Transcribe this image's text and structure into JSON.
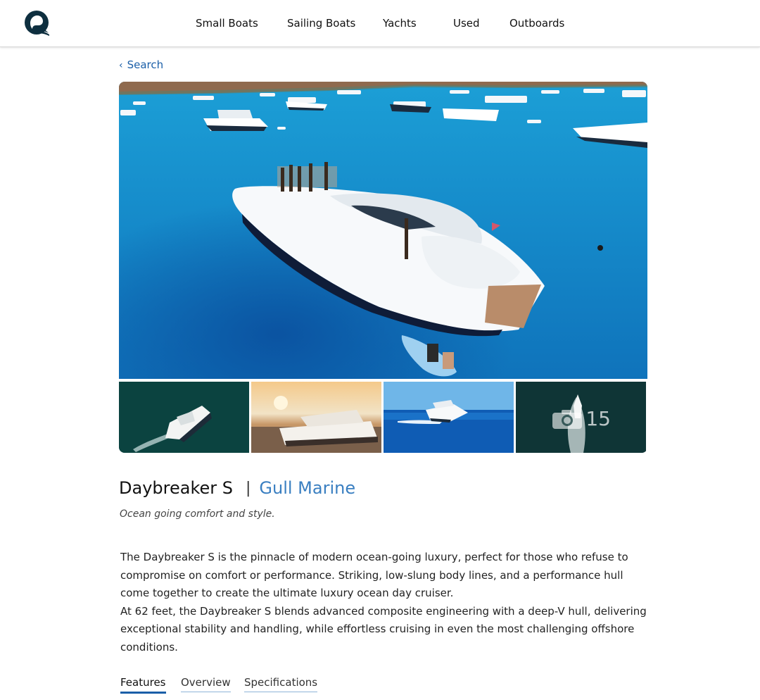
{
  "header": {
    "logo_icon": "seal-logo-icon",
    "nav": [
      {
        "label": "Small Boats"
      },
      {
        "label": "Sailing Boats"
      },
      {
        "label": "Yachts"
      },
      {
        "label": "Used"
      },
      {
        "label": "Outboards"
      }
    ]
  },
  "back_link": {
    "label": "Search",
    "icon": "chevron-left-icon"
  },
  "gallery": {
    "more_photos_count": "15",
    "more_photos_icon": "camera-icon"
  },
  "product": {
    "name": "Daybreaker S",
    "separator": "|",
    "brand": "Gull Marine",
    "tagline": "Ocean going comfort and style.",
    "description": [
      "The Daybreaker S is the pinnacle of modern ocean-going luxury, perfect for those who refuse to compromise on comfort or performance. Striking, low-slung body lines, and a performance hull come together to create the ultimate luxury ocean day cruiser.",
      "At 62 feet, the Daybreaker S blends advanced composite engineering with a deep-V hull, delivering exceptional stability and handling, while effortless cruising in even the most challenging offshore conditions."
    ]
  },
  "tabs": [
    {
      "label": "Features",
      "active": true
    },
    {
      "label": "Overview",
      "active": false
    },
    {
      "label": "Specifications",
      "active": false
    }
  ],
  "colors": {
    "accent": "#1b5fa8",
    "brand_link": "#3a7fc1",
    "logo": "#0e2f3f"
  }
}
